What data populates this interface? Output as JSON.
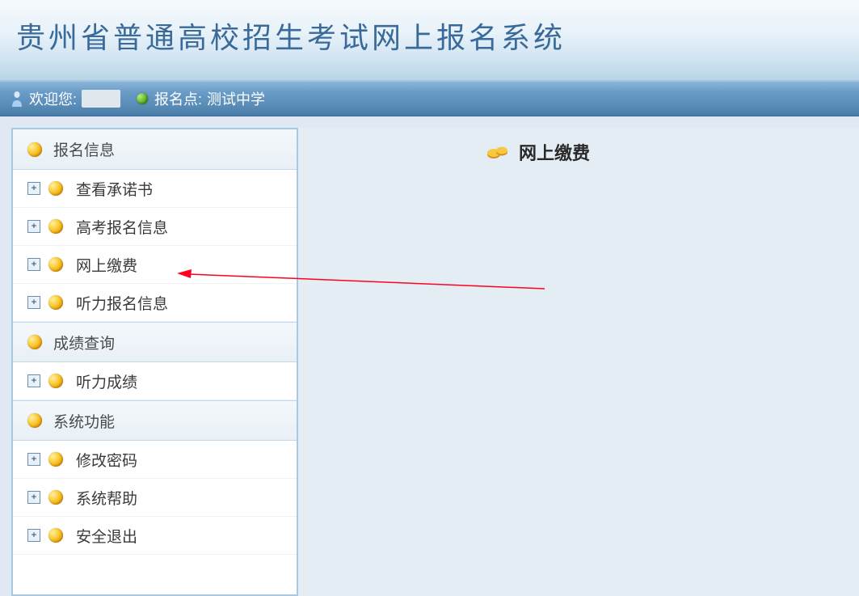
{
  "header": {
    "title": "贵州省普通高校招生考试网上报名系统"
  },
  "topbar": {
    "welcome_label": "欢迎您:",
    "user_value": "",
    "site_label": "报名点:",
    "site_value": "测试中学"
  },
  "sidebar": {
    "sections": [
      {
        "title": "报名信息",
        "items": [
          {
            "label": "查看承诺书"
          },
          {
            "label": "高考报名信息"
          },
          {
            "label": "网上缴费"
          },
          {
            "label": "听力报名信息"
          }
        ]
      },
      {
        "title": "成绩查询",
        "items": [
          {
            "label": "听力成绩"
          }
        ]
      },
      {
        "title": "系统功能",
        "items": [
          {
            "label": "修改密码"
          },
          {
            "label": "系统帮助"
          },
          {
            "label": "安全退出"
          }
        ]
      }
    ]
  },
  "main": {
    "title": "网上缴费"
  },
  "icons": {
    "plus": "+"
  }
}
